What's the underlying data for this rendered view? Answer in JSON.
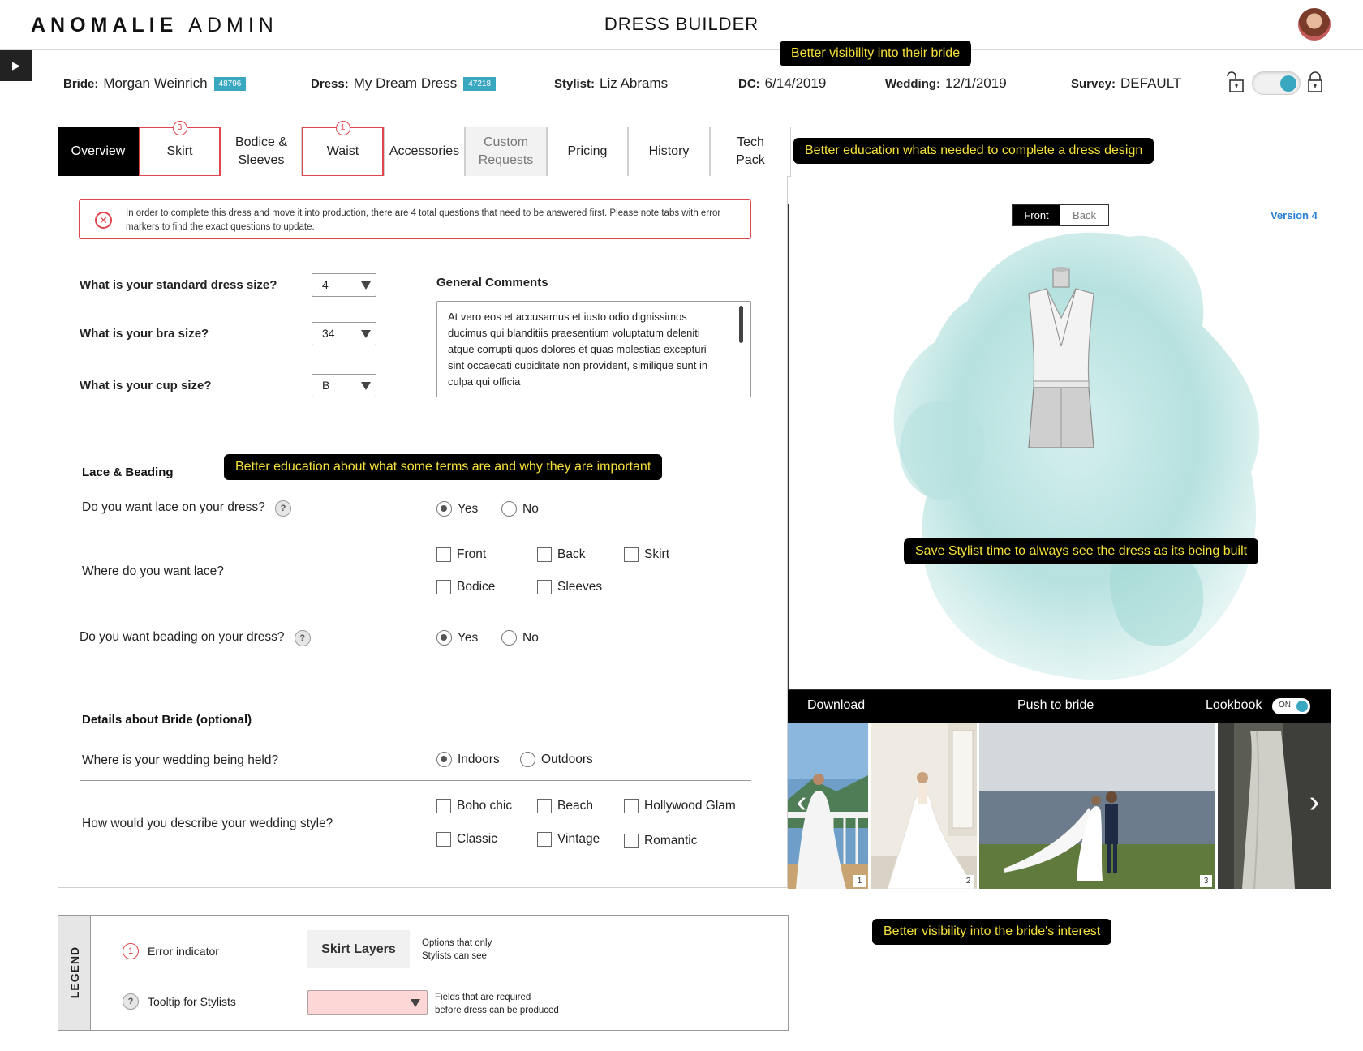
{
  "header": {
    "logo_bold": "ANOMALIE",
    "logo_light": "ADMIN",
    "page_title": "DRESS BUILDER"
  },
  "info": {
    "bride_label": "Bride:",
    "bride_name": "Morgan Weinrich",
    "bride_id": "48796",
    "dress_label": "Dress:",
    "dress_name": "My Dream Dress",
    "dress_id": "47218",
    "stylist_label": "Stylist:",
    "stylist_name": "Liz Abrams",
    "dc_label": "DC:",
    "dc_date": "6/14/2019",
    "wedding_label": "Wedding:",
    "wedding_date": "12/1/2019",
    "survey_label": "Survey:",
    "survey_value": "DEFAULT"
  },
  "callouts": {
    "bride_visibility": "Better visibility into their bride",
    "education_complete": "Better education whats needed to complete a dress design",
    "education_terms": "Better education about what some terms are and why they are important",
    "stylist_time": "Save Stylist time to always see the dress as its being built",
    "bride_interest": "Better visibility into the bride's interest"
  },
  "tabs": [
    {
      "label": "Overview"
    },
    {
      "label": "Skirt",
      "errors": "3"
    },
    {
      "label": "Bodice & Sleeves"
    },
    {
      "label": "Waist",
      "errors": "1"
    },
    {
      "label": "Accessories"
    },
    {
      "label": "Custom Requests"
    },
    {
      "label": "Pricing"
    },
    {
      "label": "History"
    },
    {
      "label": "Tech Pack"
    }
  ],
  "error_banner": {
    "message": "In order to complete this dress and move it into production, there are 4 total questions that need to be answered first. Please note tabs with error markers to find the exact questions to update."
  },
  "sizes": {
    "dress_q": "What is your standard dress size?",
    "dress_val": "4",
    "bra_q": "What is your bra size?",
    "bra_val": "34",
    "cup_q": "What is your cup size?",
    "cup_val": "B"
  },
  "comments": {
    "title": "General Comments",
    "text": "At vero eos et accusamus et iusto odio dignissimos ducimus qui blanditiis praesentium voluptatum deleniti atque corrupti quos dolores et quas molestias excepturi sint occaecati cupiditate non provident, similique sunt in culpa qui officia"
  },
  "lace": {
    "section": "Lace & Beading",
    "lace_q": "Do you want lace on your dress?",
    "yes": "Yes",
    "no": "No",
    "where_q": "Where do you want lace?",
    "where_opts": [
      "Front",
      "Back",
      "Skirt",
      "Bodice",
      "Sleeves"
    ],
    "beading_q": "Do you want beading on your dress?"
  },
  "bride_details": {
    "section": "Details about Bride (optional)",
    "venue_q": "Where is your wedding being held?",
    "indoors": "Indoors",
    "outdoors": "Outdoors",
    "style_q": "How would you describe your wedding style?",
    "style_opts": [
      "Boho chic",
      "Beach",
      "Hollywood Glam",
      "Classic",
      "Vintage",
      "Romantic"
    ]
  },
  "preview": {
    "front": "Front",
    "back": "Back",
    "version": "Version 4"
  },
  "actions": {
    "download": "Download",
    "push": "Push to bride",
    "lookbook": "Lookbook",
    "toggle_on": "ON"
  },
  "gallery": {
    "numbers": [
      "1",
      "2",
      "3"
    ]
  },
  "legend": {
    "title": "LEGEND",
    "error_num": "1",
    "error_label": "Error indicator",
    "help_glyph": "?",
    "tooltip_label": "Tooltip for Stylists",
    "sample_button": "Skirt Layers",
    "stylist_only_1": "Options that only",
    "stylist_only_2": "Stylists can see",
    "required_1": "Fields that are required",
    "required_2": "before dress can be produced"
  },
  "colors": {
    "accent": "#3aa7c1",
    "error": "#e0464b",
    "callout_text": "#f6e13b",
    "link": "#2a7fd4"
  }
}
